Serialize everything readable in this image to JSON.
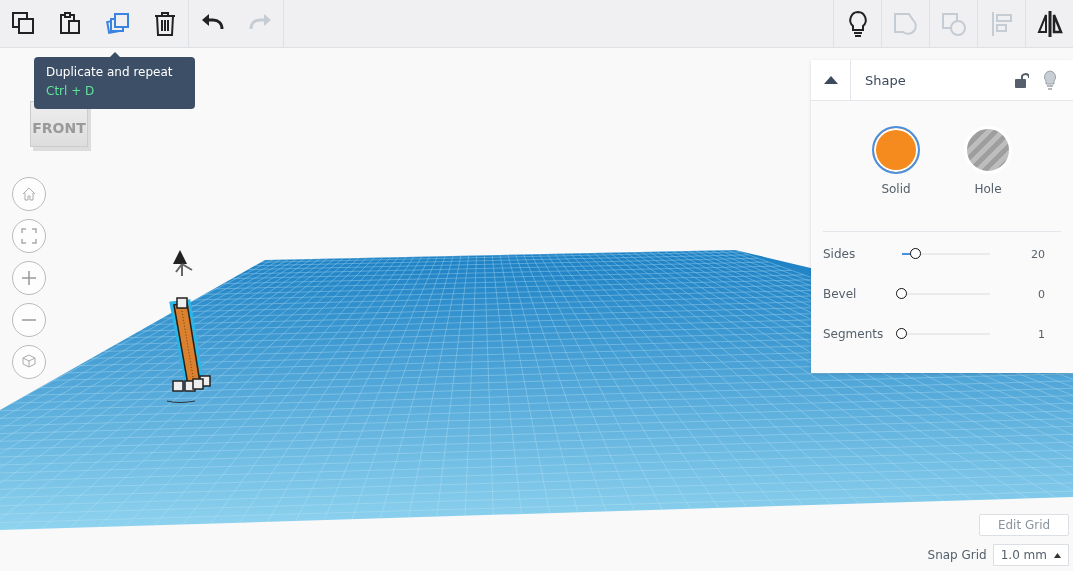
{
  "toolbar": {
    "left_tools": [
      {
        "kind": "copy",
        "disabled": false,
        "highlighted": false
      },
      {
        "kind": "paste",
        "disabled": false,
        "highlighted": false
      },
      {
        "kind": "duplicate",
        "disabled": false,
        "highlighted": true
      },
      {
        "kind": "delete",
        "disabled": false,
        "highlighted": false
      },
      {
        "kind": "undo",
        "disabled": false,
        "highlighted": false
      },
      {
        "kind": "redo",
        "disabled": true,
        "highlighted": false
      }
    ],
    "right_tools": [
      {
        "kind": "notes",
        "disabled": false
      },
      {
        "kind": "group",
        "disabled": true
      },
      {
        "kind": "ungroup",
        "disabled": true
      },
      {
        "kind": "align",
        "disabled": true
      },
      {
        "kind": "mirror",
        "disabled": false
      }
    ]
  },
  "tooltip": {
    "title": "Duplicate and repeat",
    "shortcut": "Ctrl + D"
  },
  "view_cube": {
    "label": "FRONT"
  },
  "shape_panel": {
    "title": "Shape",
    "locked": false,
    "types": [
      {
        "kind": "solid",
        "label": "Solid",
        "selected": true
      },
      {
        "kind": "hole",
        "label": "Hole",
        "selected": false
      }
    ],
    "sliders": [
      {
        "label": "Sides",
        "value": "20",
        "level": 0.14
      },
      {
        "label": "Bevel",
        "value": "0",
        "level": 0
      },
      {
        "label": "Segments",
        "value": "1",
        "level": 0
      }
    ]
  },
  "grid": {
    "edit_button": "Edit Grid",
    "snap_label": "Snap Grid",
    "snap_value": "1.0 mm"
  }
}
